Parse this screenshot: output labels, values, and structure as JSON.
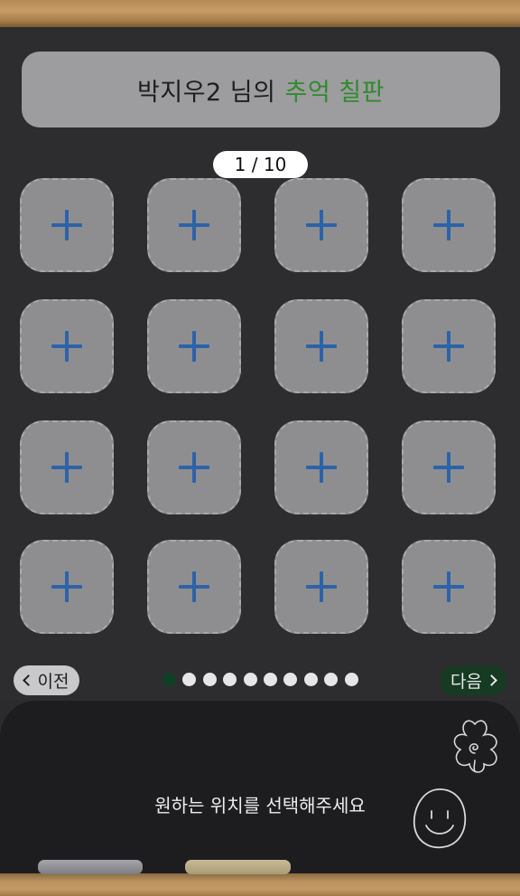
{
  "header": {
    "title_prefix": "박지우2 님의",
    "title_accent": "추억 칠판",
    "accent_color": "#2e8b2e"
  },
  "pager": {
    "label": "1 / 10",
    "current": 1,
    "total": 10
  },
  "slots": {
    "count": 16,
    "icon": "plus-icon",
    "icon_color": "#2c63a8"
  },
  "nav": {
    "prev_label": "이전",
    "next_label": "다음"
  },
  "tray": {
    "hint": "원하는 위치를 선택해주세요"
  },
  "decor": {
    "flower": "flower-doodle-icon",
    "smiley": "smiley-doodle-icon"
  }
}
